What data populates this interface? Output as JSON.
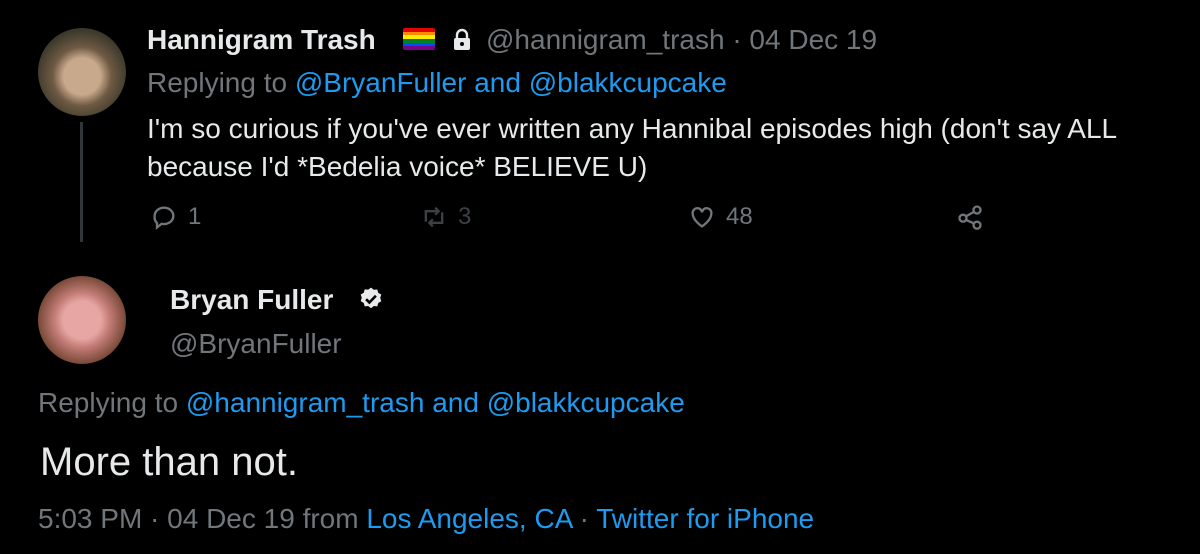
{
  "tweet1": {
    "display_name": "Hannigram Trash",
    "handle_and_date": "@hannigram_trash · 04 Dec 19",
    "replying_prefix": "Replying to ",
    "replying_links": "@BryanFuller and @blakkcupcake",
    "text": "I'm so curious if you've ever written any Hannibal episodes high (don't say ALL because I'd *Bedelia voice* BELIEVE U)",
    "reply_count": "1",
    "retweet_count": "3",
    "like_count": "48",
    "icons": [
      "pride-flag-icon",
      "lock-icon",
      "reply-icon",
      "retweet-icon",
      "like-icon",
      "share-icon"
    ],
    "pride_colors": [
      "#e40303",
      "#ff8c00",
      "#ffed00",
      "#008026",
      "#004dff",
      "#750787"
    ]
  },
  "tweet2": {
    "display_name": "Bryan Fuller",
    "handle": "@BryanFuller",
    "replying_prefix": "Replying to ",
    "replying_links": "@hannigram_trash and @blakkcupcake",
    "text": "More than not.",
    "time_date": "5:03 PM · 04 Dec 19 from ",
    "location": "Los Angeles, CA",
    "separator": " · ",
    "source": "Twitter for iPhone",
    "icons": [
      "verified-icon"
    ]
  },
  "colors": {
    "background": "#000000",
    "text_primary": "#e7e9ea",
    "text_secondary": "#71767b",
    "link": "#1d9bf0",
    "retweet_disabled": "#3e4144"
  }
}
